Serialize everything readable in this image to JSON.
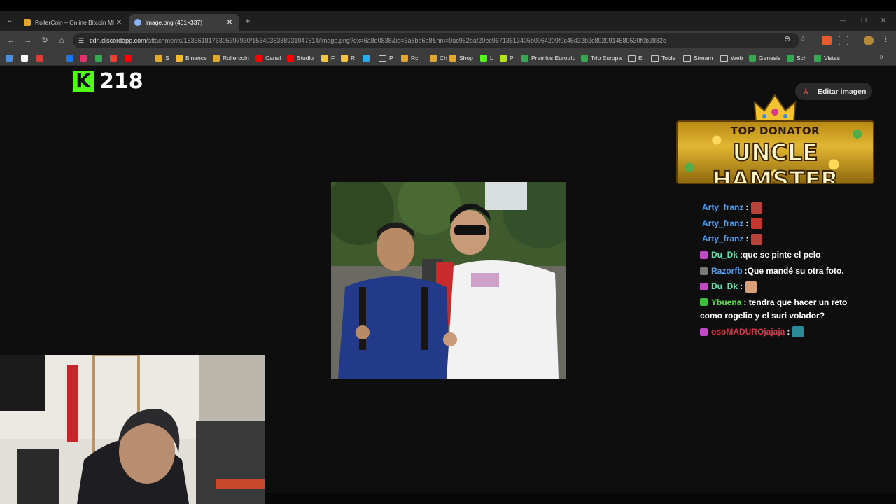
{
  "tabs": [
    {
      "title": "RollerCoin – Online Bitcoin Mi",
      "favicon_color": "#e2a72e"
    },
    {
      "title": "image.png (401×337)",
      "favicon_color": "#8ab4f8"
    }
  ],
  "address": {
    "host": "cdn.discordapp.com",
    "path": "/attachments/1533618176305397930/1534036388931047514/image.png?ex=6a8d0838&is=6a8bb6b8&hm=9ac952baf20ec96713613405b0964209f0c46d32b2c89209145805​30f0b2882c"
  },
  "bookmarks": [
    {
      "label": "",
      "color": "#4a90e2"
    },
    {
      "label": "",
      "color": "#ffffff"
    },
    {
      "label": "",
      "color": "#e53935"
    },
    {
      "label": "",
      "color": "#3c3c3c"
    },
    {
      "label": "",
      "color": "#1877f2"
    },
    {
      "label": "",
      "color": "#e1306c"
    },
    {
      "label": "",
      "color": "#34a853"
    },
    {
      "label": "",
      "color": "#ea4335"
    },
    {
      "label": "",
      "color": "#ff0000"
    },
    {
      "label": "",
      "color": "#3c3c3c"
    },
    {
      "label": "",
      "color": "#ffffff"
    },
    {
      "label": "S",
      "color": "#e2a72e"
    },
    {
      "label": "Binance",
      "color": "#f3ba2f"
    },
    {
      "label": "Rollercoin",
      "color": "#e2a72e"
    },
    {
      "label": "Canal",
      "color": "#ff0000"
    },
    {
      "label": "Studio",
      "color": "#ff0000"
    },
    {
      "label": "F",
      "color": "#f5c542"
    },
    {
      "label": "R",
      "color": "#f5c542"
    },
    {
      "label": "",
      "color": "#2aabee"
    },
    {
      "label": "P",
      "color": "folder"
    },
    {
      "label": "Rc",
      "color": "#e2a72e"
    },
    {
      "label": "Ch",
      "color": "#e2a72e"
    },
    {
      "label": "Shop",
      "color": "#e2a72e"
    },
    {
      "label": "L",
      "color": "#53fc18"
    },
    {
      "label": "P",
      "color": "#b4e61e"
    },
    {
      "label": "Premios Eurotrip",
      "color": "#34a853"
    },
    {
      "label": "Trip Europa",
      "color": "#34a853"
    },
    {
      "label": "E",
      "color": "folder"
    },
    {
      "label": "Tools",
      "color": "folder"
    },
    {
      "label": "Stream",
      "color": "folder"
    },
    {
      "label": "Web",
      "color": "folder"
    },
    {
      "label": "Genesis",
      "color": "#34a853"
    },
    {
      "label": "Sch",
      "color": "#34a853"
    },
    {
      "label": "Vistas",
      "color": "#34a853"
    }
  ],
  "overlay": {
    "viewer_count": "218",
    "edit_button": "Editar imagen",
    "donator_title": "TOP DONATOR",
    "donator_name": "UNCLE HAMSTER"
  },
  "chat": [
    {
      "user": "Arty_franz",
      "user_color": "#4d9ff0",
      "badge": null,
      "text": "",
      "emote": "#b5453c"
    },
    {
      "user": "Arty_franz",
      "user_color": "#4d9ff0",
      "badge": null,
      "text": "",
      "emote": "#c2382e"
    },
    {
      "user": "Arty_franz",
      "user_color": "#4d9ff0",
      "badge": null,
      "text": "",
      "emote": "#b5453c"
    },
    {
      "user": "Du_Dk",
      "user_color": "#53e6a8",
      "badge": "#c04ac6",
      "text": "que se pinte el pelo",
      "emote": null
    },
    {
      "user": "Razorfb",
      "user_color": "#4d9ff0",
      "badge": "#7a7a7a",
      "text": "Que mandé su otra foto.",
      "emote": null
    },
    {
      "user": "Du_Dk",
      "user_color": "#53e6a8",
      "badge": "#c04ac6",
      "text": "",
      "emote": "#d9a07a"
    },
    {
      "user": "Ybuena",
      "user_color": "#53e63a",
      "badge": "#3fbf3f",
      "text": "tendra que hacer un reto como rogelio y el suri volador?",
      "emote": null
    },
    {
      "user": "osoMADUROjajaja",
      "user_color": "#e0344a",
      "badge": "#c04ac6",
      "text": "",
      "emote": "#2a8a9a"
    }
  ]
}
